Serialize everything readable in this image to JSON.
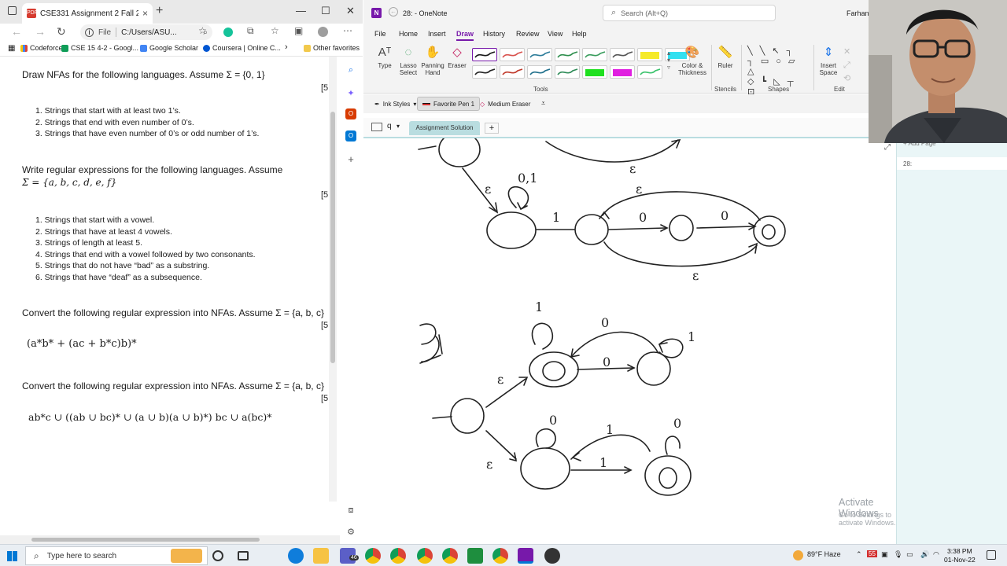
{
  "browser": {
    "tab_title": "CSE331 Assignment 2 Fall 2022...",
    "tab_close": "×",
    "new_tab": "+",
    "window_controls": [
      "—",
      "☐",
      "✕"
    ],
    "address_label": "File",
    "address_url": "C:/Users/ASU...",
    "bookmarks": [
      "Codeforces",
      "CSE 15 4-2 - Googl...",
      "Google Scholar",
      "Coursera | Online C...",
      "Other favorites"
    ],
    "icons": [
      "back-icon",
      "forward-icon",
      "reload-icon",
      "info-icon",
      "zoom-icon",
      "favorites-star-icon",
      "grammarly-icon",
      "extensions-icon",
      "collections-icon",
      "profile-avatar-icon",
      "more-icon"
    ]
  },
  "pdf": {
    "q1_title": "Draw NFAs for the following languages. Assume Σ = {0, 1}",
    "q1_marks": "[5",
    "q1_items": [
      "1.   Strings that start with at least two 1’s.",
      "2.   Strings that end with even number of 0’s.",
      "3.   Strings that have even number of 0’s or odd number of 1’s."
    ],
    "q2_title_line1": "Write regular expressions for the following languages. Assume",
    "q2_title_line2": "Σ = {a, b, c, d, e, f}",
    "q2_marks": "[5",
    "q2_items": [
      "1.   Strings that start with a vowel.",
      "2.   Strings that have at least 4 vowels.",
      "3.   Strings of length at least 5.",
      "4.   Strings that end with a vowel followed by two consonants.",
      "5.   Strings that do not have “bad” as a substring.",
      "6.   Strings that have “deaf” as a subsequence."
    ],
    "q3_title": "Convert the following regular expression into NFAs. Assume Σ = {a, b, c}",
    "q3_marks": "[5",
    "q3_expr": "(a*b* + (ac + b*c)b)*",
    "q4_title": "Convert the following regular expression into NFAs. Assume Σ = {a, b, c}",
    "q4_marks": "[5",
    "q4_expr": "ab*c ∪ ((ab ∪ bc)* ∪ (a ∪ b)(a ∪ b)*) bc ∪ a(bc)*"
  },
  "onenote": {
    "title": "28: - OneNote",
    "search_placeholder": "Search (Alt+Q)",
    "user": "Farhan",
    "menu": [
      "File",
      "Home",
      "Insert",
      "Draw",
      "History",
      "Review",
      "View",
      "Help"
    ],
    "active_menu": "Draw",
    "tools": {
      "type": "Type",
      "lasso": "Lasso Select",
      "panning": "Panning Hand",
      "eraser": "Eraser",
      "color_thickness": "Color & Thickness",
      "ruler": "Ruler",
      "insert_space": "Insert Space",
      "group_tools": "Tools",
      "group_stencils": "Stencils",
      "group_shapes": "Shapes",
      "group_edit": "Edit"
    },
    "pen_colors": [
      "#1a1a1a",
      "#d9534f",
      "#2e7d9a",
      "#2f8f4e",
      "#3a9d5d",
      "#555555",
      "#f5ea2a",
      "#33e0f0",
      "#222222",
      "#c0392b",
      "#1f6f8b",
      "#2e8b57",
      "#1fe01f",
      "#e01fe0",
      "#39c26b"
    ],
    "ink_styles": "Ink Styles",
    "favorite_pen": "Favorite Pen 1",
    "medium_eraser": "Medium Eraser",
    "section_tab": "Assignment Solution",
    "add_tab": "+",
    "notebook_icon_label": "q",
    "add_page": "Add Page",
    "page_entry": "28:",
    "watermark_title": "Activate Windows",
    "watermark_sub": "Go to Settings to activate Windows."
  },
  "canvas_labels": {
    "eps_top": "ε",
    "loop_01": "0,1",
    "eps_left": "ε",
    "one_a": "1",
    "eps_upper": "ε",
    "zero_a": "0",
    "zero_b": "0",
    "eps_lower": "ε",
    "q3_label": "3)",
    "one_loop_a": "1",
    "zero_top": "0",
    "one_loop_b": "1",
    "zero_mid": "0",
    "eps_mid_top": "ε",
    "zero_loop_c": "0",
    "one_top_c": "1",
    "zero_loop_d": "0",
    "one_mid_c": "1",
    "eps_mid_bottom": "ε"
  },
  "taskbar": {
    "search_placeholder": "Type here to search",
    "weather": "89°F  Haze",
    "badge": "55",
    "time": "3:38 PM",
    "date": "01-Nov-22",
    "notification_badge": "46"
  }
}
